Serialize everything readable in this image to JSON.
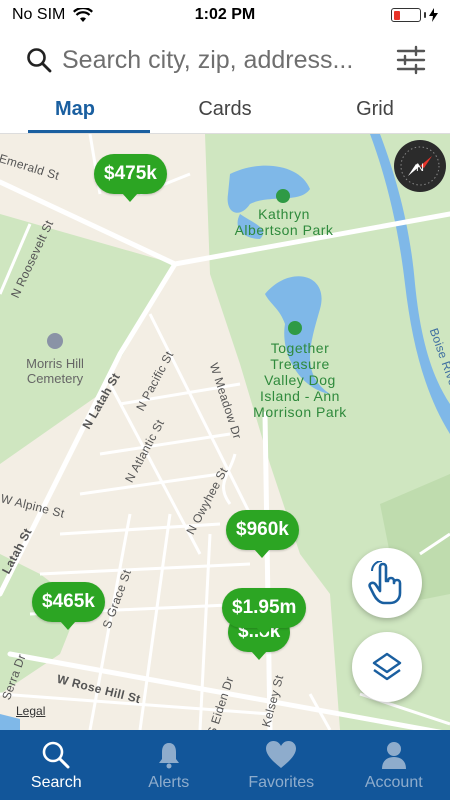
{
  "status_bar": {
    "carrier": "No SIM",
    "time": "1:02 PM"
  },
  "search": {
    "placeholder": "Search city, zip, address..."
  },
  "tabs": [
    {
      "label": "Map",
      "active": true
    },
    {
      "label": "Cards",
      "active": false
    },
    {
      "label": "Grid",
      "active": false
    }
  ],
  "map": {
    "streets": {
      "emerald": "Emerald St",
      "n_roosevelt": "N Roosevelt St",
      "n_latah": "N Latah St",
      "latah": "Latah St",
      "n_pacific": "N Pacific St",
      "n_atlantic": "N Atlantic St",
      "w_meadow": "W Meadow Dr",
      "n_owyhee": "N Owyhee St",
      "w_alpine": "W Alpine St",
      "w_rose_hill": "W Rose Hill St",
      "boise_river": "Boise River",
      "s_grace": "S Grace St",
      "s_eiden": "S Eiden Dr",
      "kelsey": "Kelsey St",
      "serra": "Serra Dr"
    },
    "parks": {
      "kathryn": "Kathryn Albertson Park",
      "kathryn_line1": "Kathryn",
      "kathryn_line2": "Albertson Park",
      "together_l1": "Together",
      "together_l2": "Treasure",
      "together_l3": "Valley Dog",
      "together_l4": "Island - Ann",
      "together_l5": "Morrison Park"
    },
    "poi": {
      "morris_l1": "Morris Hill",
      "morris_l2": "Cemetery"
    },
    "pins": [
      {
        "label": "$475k"
      },
      {
        "label": "$960k"
      },
      {
        "label": "$465k"
      },
      {
        "label": "$1.95m"
      },
      {
        "label": "$..8k"
      }
    ],
    "legal": "Legal",
    "compass_letter": "N"
  },
  "nav": [
    {
      "label": "Search",
      "icon": "search-icon",
      "active": true
    },
    {
      "label": "Alerts",
      "icon": "bell-icon",
      "active": false
    },
    {
      "label": "Favorites",
      "icon": "heart-icon",
      "active": false
    },
    {
      "label": "Account",
      "icon": "person-icon",
      "active": false
    }
  ],
  "colors": {
    "accent": "#1a5fa0",
    "nav_bg": "#12569a",
    "pin_green": "#2ca523",
    "park_green": "#cfe6c0",
    "water": "#7fb8e8"
  }
}
